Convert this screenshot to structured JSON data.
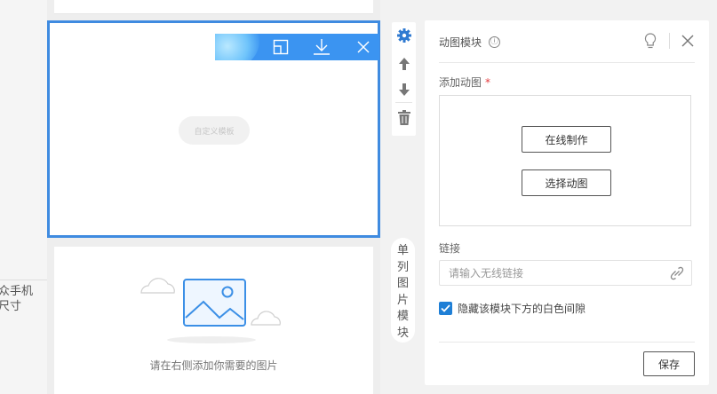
{
  "left_panel": {
    "label_line1": "众手机",
    "label_line2": "尺寸"
  },
  "canvas": {
    "custom_template_label": "自定义模板",
    "image_module_hint": "请在右侧添加你需要的图片"
  },
  "module_name": "单列图片模块",
  "panel": {
    "title": "动图模块",
    "info_icon": "ⓘ",
    "animated_label": "添加动图",
    "required_mark": "*",
    "online_make_label": "在线制作",
    "select_animated_label": "选择动图",
    "link_label": "链接",
    "link_placeholder": "请输入无线链接",
    "hide_gap_label": "隐藏该模块下方的白色间隙",
    "hide_gap_checked": true,
    "save_label": "保存"
  },
  "colors": {
    "accent": "#3b94f1",
    "selection_border": "#3f8be0",
    "checkbox": "#1f7fd6",
    "required": "#e4393c"
  },
  "icons": {
    "toolbar": [
      "restore-icon",
      "download-icon",
      "close-icon"
    ],
    "side_tools": [
      "gear-icon",
      "arrow-up-icon",
      "arrow-down-icon",
      "trash-icon"
    ],
    "panel": [
      "info-icon",
      "lightbulb-icon",
      "close-icon",
      "link-icon",
      "checkmark-icon"
    ]
  }
}
